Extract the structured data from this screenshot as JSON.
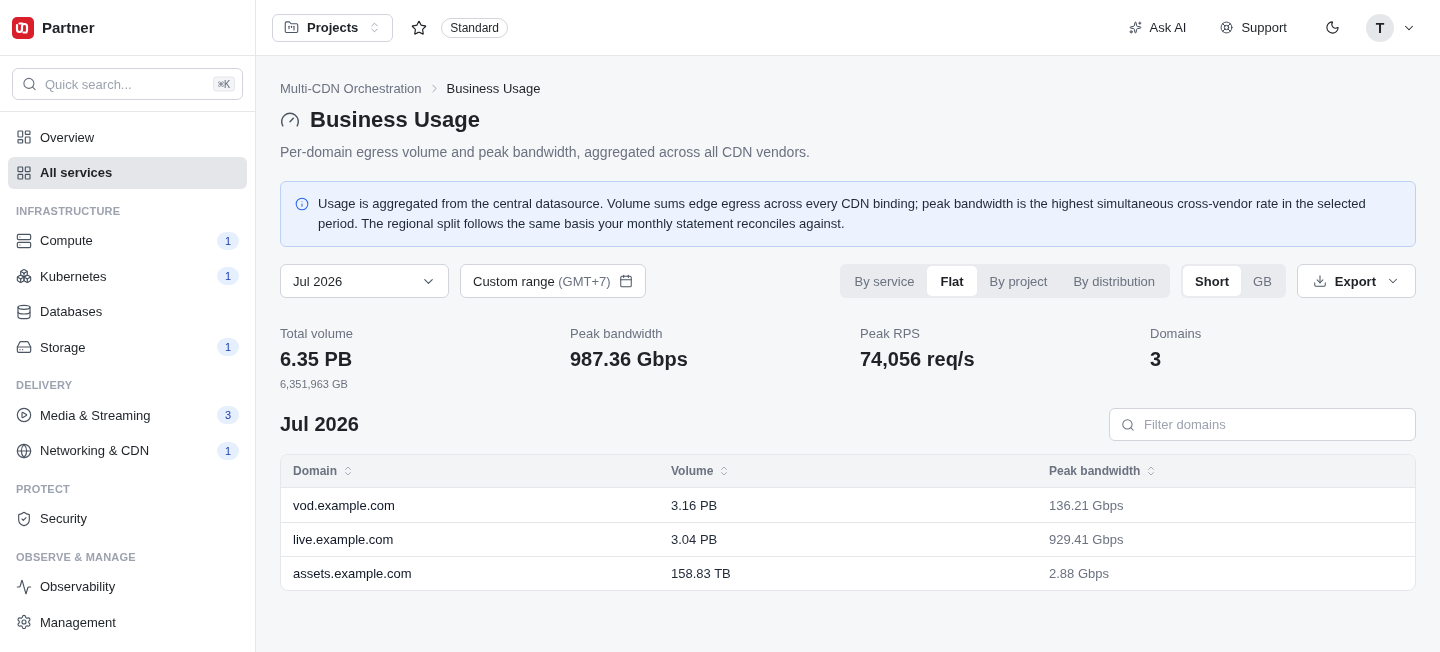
{
  "sidebar": {
    "brand": "Partner",
    "search": {
      "placeholder": "Quick search...",
      "shortcut": "⌘K"
    },
    "items": [
      {
        "label": "Overview",
        "selected": false
      },
      {
        "label": "All services",
        "selected": true
      }
    ],
    "sections": [
      {
        "title": "INFRASTRUCTURE",
        "items": [
          {
            "label": "Compute",
            "badge": "1",
            "selected": false
          },
          {
            "label": "Kubernetes",
            "badge": "1",
            "selected": false
          },
          {
            "label": "Databases",
            "selected": false
          },
          {
            "label": "Storage",
            "badge": "1",
            "selected": false
          }
        ]
      },
      {
        "title": "DELIVERY",
        "items": [
          {
            "label": "Media & Streaming",
            "badge": "3",
            "selected": false
          },
          {
            "label": "Networking & CDN",
            "badge": "1",
            "selected": false
          }
        ]
      },
      {
        "title": "PROTECT",
        "items": [
          {
            "label": "Security",
            "selected": false
          }
        ]
      },
      {
        "title": "OBSERVE & MANAGE",
        "items": [
          {
            "label": "Observability",
            "selected": false
          },
          {
            "label": "Management",
            "selected": false
          }
        ]
      }
    ]
  },
  "topbar": {
    "project_switcher": "Projects",
    "plan": "Standard",
    "actions": [
      {
        "label": "Ask AI"
      },
      {
        "label": "Support"
      }
    ],
    "user_initial": "T"
  },
  "page": {
    "breadcrumb": [
      "Multi-CDN Orchestration",
      "Business Usage"
    ],
    "title": "Business Usage",
    "subtitle": "Per-domain egress volume and peak bandwidth, aggregated across all CDN vendors.",
    "notice": "Usage is aggregated from the central datasource. Volume sums edge egress across every CDN binding; peak bandwidth is the highest simultaneous cross-vendor rate in the selected period. The regional split follows the same basis your monthly statement reconciles against."
  },
  "toolbar": {
    "month": "Jul 2026",
    "range": {
      "label": "Custom range",
      "timezone": "(GMT+7)"
    },
    "grouping": [
      {
        "label": "By service",
        "selected": false
      },
      {
        "label": "Flat",
        "selected": true
      },
      {
        "label": "By project",
        "selected": false
      },
      {
        "label": "By distribution",
        "selected": false
      }
    ],
    "units": [
      {
        "label": "Short",
        "selected": true
      },
      {
        "label": "GB",
        "selected": false
      }
    ],
    "export": "Export"
  },
  "metrics": [
    {
      "label": "Total volume",
      "value": "6.35 PB",
      "detail": "6,351,963 GB"
    },
    {
      "label": "Peak bandwidth",
      "value": "987.36 Gbps"
    },
    {
      "label": "Peak RPS",
      "value": "74,056 req/s"
    },
    {
      "label": "Domains",
      "value": "3"
    }
  ],
  "period": {
    "heading": "Jul 2026",
    "filter": {
      "placeholder": "Filter domains"
    }
  },
  "table": {
    "columns": [
      "Domain",
      "Volume",
      "Peak bandwidth"
    ],
    "rows": [
      [
        "vod.example.com",
        "3.16 PB",
        "136.21 Gbps"
      ],
      [
        "live.example.com",
        "3.04 PB",
        "929.41 Gbps"
      ],
      [
        "assets.example.com",
        "158.83 TB",
        "2.88 Gbps"
      ]
    ]
  }
}
